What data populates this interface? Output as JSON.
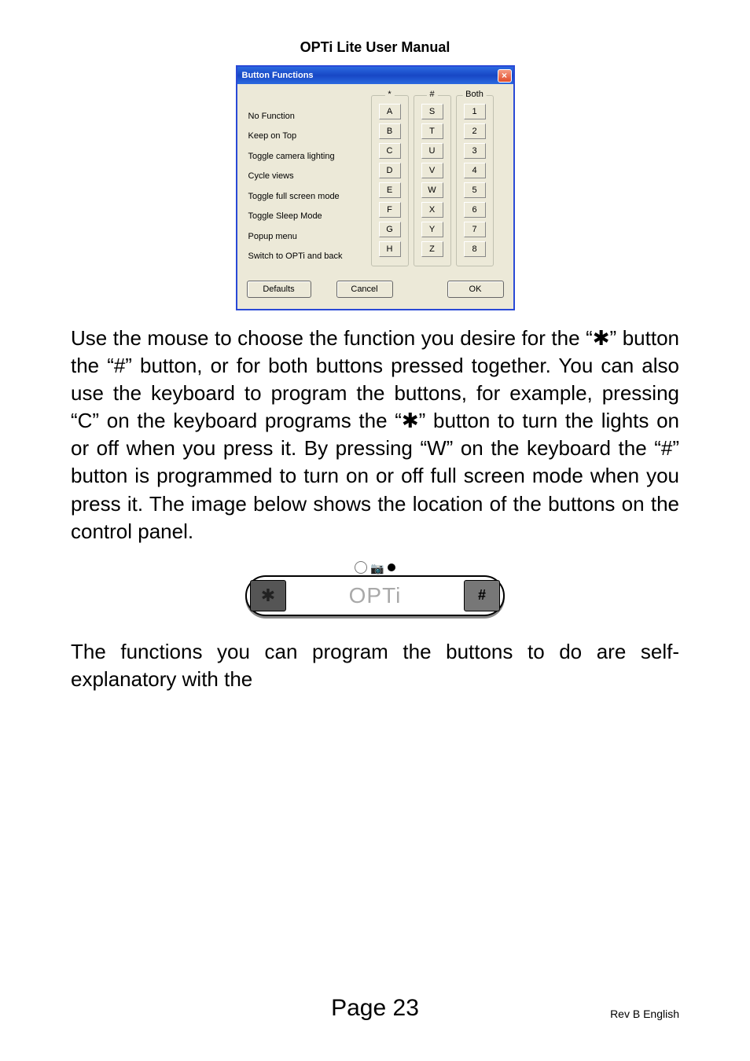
{
  "title": "OPTi Lite User Manual",
  "dialog": {
    "title": "Button Functions",
    "functions": [
      "No Function",
      "Keep on Top",
      "Toggle camera lighting",
      "Cycle views",
      "Toggle full screen mode",
      "Toggle Sleep Mode",
      "Popup menu",
      "Switch to OPTi and back"
    ],
    "cols": {
      "star": {
        "label": "*",
        "keys": [
          "A",
          "B",
          "C",
          "D",
          "E",
          "F",
          "G",
          "H"
        ]
      },
      "hash": {
        "label": "#",
        "keys": [
          "S",
          "T",
          "U",
          "V",
          "W",
          "X",
          "Y",
          "Z"
        ]
      },
      "both": {
        "label": "Both",
        "keys": [
          "1",
          "2",
          "3",
          "4",
          "5",
          "6",
          "7",
          "8"
        ]
      }
    },
    "buttons": {
      "defaults": "Defaults",
      "cancel": "Cancel",
      "ok": "OK"
    }
  },
  "para1": "Use the mouse to choose the function you desire for the “✱” button the “#” button, or for both buttons pressed together. You can also use the keyboard to program the buttons, for example, pressing “C” on the keyboard programs the “✱” button to turn the lights on or off when you press it. By pressing “W” on the keyboard the “#” button is programmed to turn on or off full screen mode when you press it. The image below shows the location of the buttons on the control panel.",
  "panel": {
    "center": "OPTi",
    "left": "✱",
    "right": "#"
  },
  "para2": "The functions you can program the buttons to do are self-explanatory with the",
  "footer": {
    "page": "Page 23",
    "rev": "Rev B English"
  }
}
